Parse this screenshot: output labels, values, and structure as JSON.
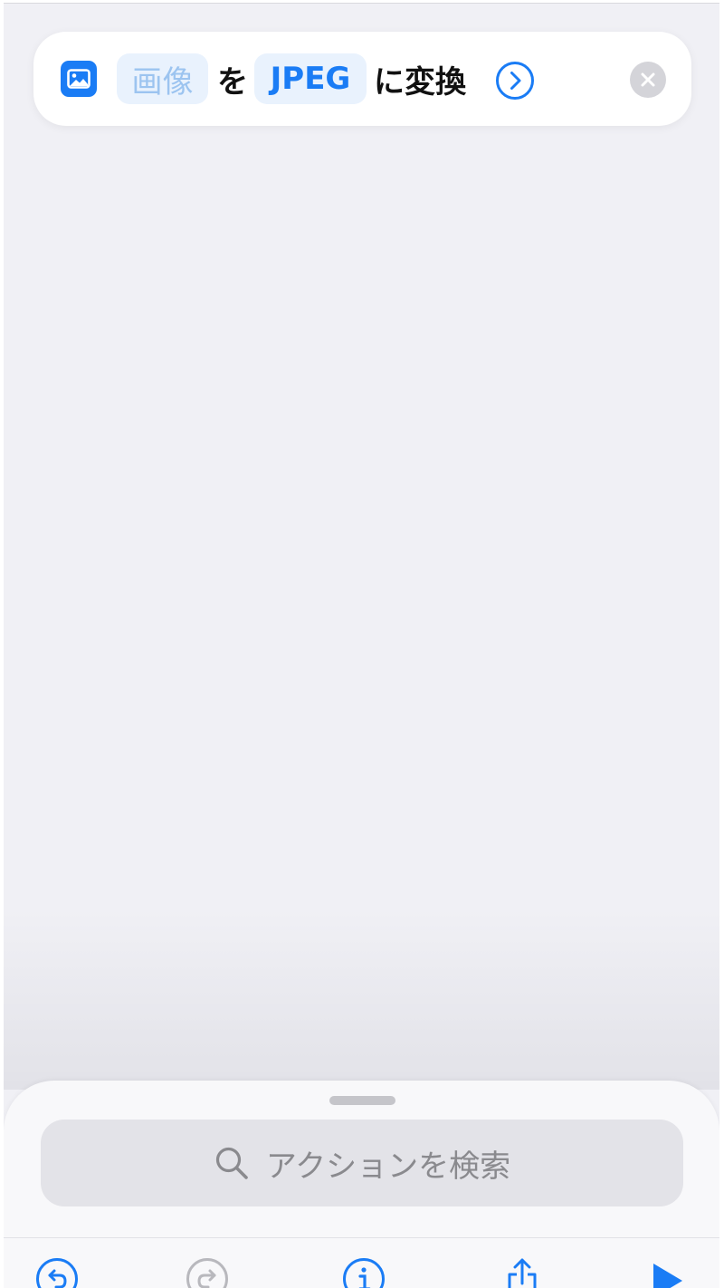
{
  "action": {
    "input_token": "画像",
    "particle": "を",
    "format_token": "JPEG",
    "verb": "に変換",
    "input_icon": "photo-icon",
    "expand_icon": "chevron-right-circle-icon",
    "remove_icon": "close-icon"
  },
  "sheet": {
    "search_placeholder": "アクションを検索",
    "search_icon": "search-icon"
  },
  "toolbar": {
    "icons": [
      "undo-icon",
      "redo-icon",
      "info-icon",
      "share-icon",
      "play-icon"
    ]
  },
  "colors": {
    "accent": "#1a7cf5",
    "background": "#f0f0f5",
    "token_bg": "#e9f2fd",
    "disabled": "#b8b8bd"
  }
}
